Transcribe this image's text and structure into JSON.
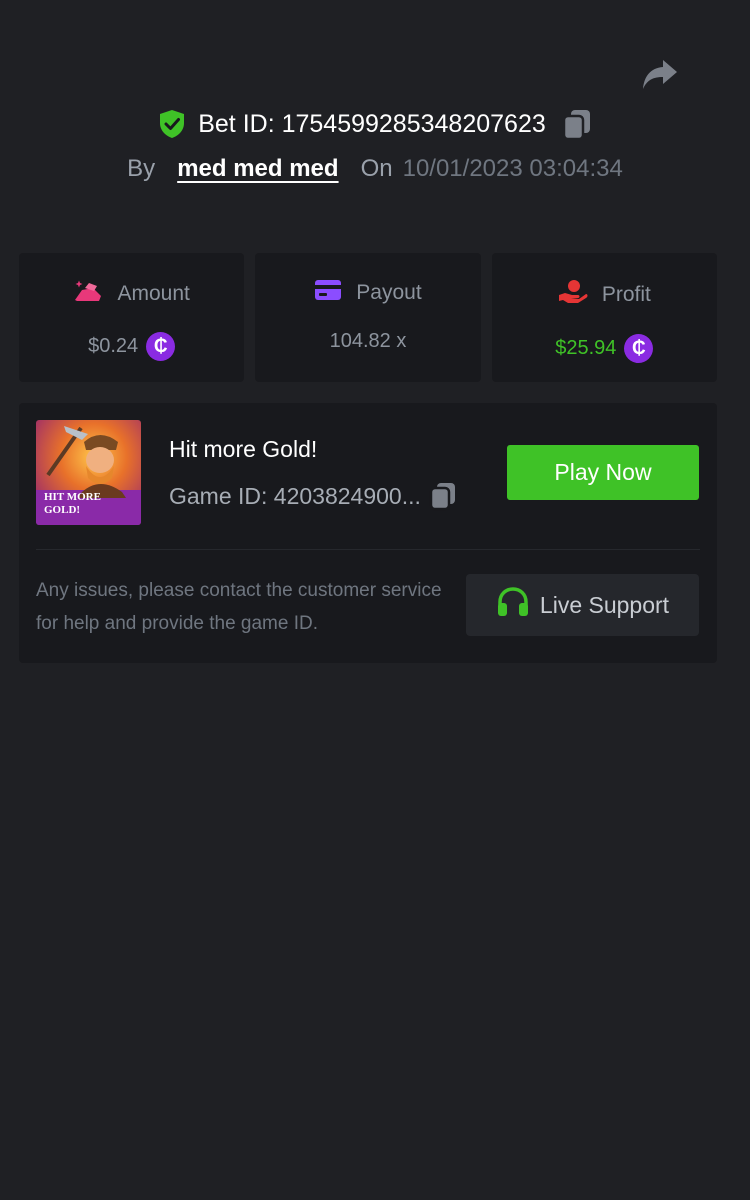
{
  "bet": {
    "id_text": "Bet ID: 1754599285348207623",
    "by_label": "By",
    "username": "med med med",
    "on_label": "On",
    "date": "10/01/2023 03:04:34"
  },
  "stats": [
    {
      "label": "Amount",
      "value": "$0.24",
      "icon": "bet-amount-icon",
      "icon_color": "#e8387a",
      "show_coin": true,
      "value_color": "#8d949e"
    },
    {
      "label": "Payout",
      "value": "104.82 x",
      "icon": "card-icon",
      "icon_color": "#8b4dff",
      "show_coin": false,
      "value_color": "#8d949e"
    },
    {
      "label": "Profit",
      "value": "$25.94",
      "icon": "hand-profit-icon",
      "icon_color": "#e53535",
      "show_coin": true,
      "value_color": "#3fc227"
    }
  ],
  "coin_symbol": "₵",
  "game": {
    "title": "Hit more Gold!",
    "id_text": "Game ID: 4203824900...",
    "thumb_text_line1": "HIT MORE",
    "thumb_text_line2": "GOLD!",
    "play_label": "Play Now"
  },
  "support": {
    "help_text": "Any issues, please contact the customer service for help and provide the game ID.",
    "button_label": "Live Support"
  },
  "colors": {
    "background": "#1f2024",
    "card": "#18191d",
    "accent_green": "#3fc227",
    "coin_purple": "#8a2be2"
  }
}
